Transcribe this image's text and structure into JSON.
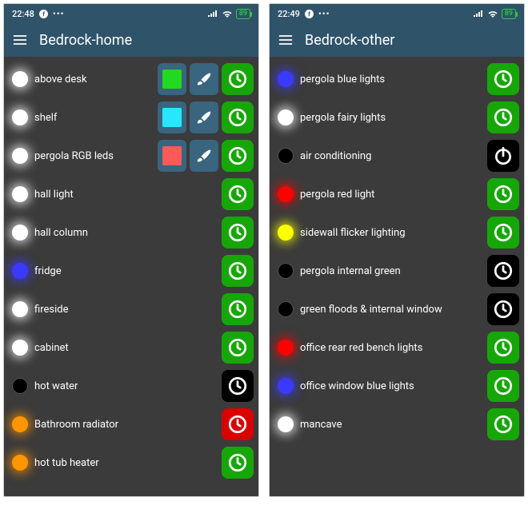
{
  "left": {
    "status": {
      "time": "22:48",
      "battery": "89"
    },
    "title": "Bedrock-home",
    "rows": [
      {
        "label": "above desk",
        "bulb": "white-glow",
        "color_swatch": "#21d921",
        "brush": true,
        "action": "clock",
        "action_bg": "green"
      },
      {
        "label": "shelf",
        "bulb": "white-glow",
        "color_swatch": "#25e8ff",
        "brush": true,
        "action": "clock",
        "action_bg": "green"
      },
      {
        "label": "pergola RGB leds",
        "bulb": "white-glow",
        "color_swatch": "#ff5959",
        "brush": true,
        "action": "clock",
        "action_bg": "green"
      },
      {
        "label": "hall light",
        "bulb": "white-glow",
        "action": "clock",
        "action_bg": "green"
      },
      {
        "label": "hall column",
        "bulb": "white-glow",
        "action": "clock",
        "action_bg": "green"
      },
      {
        "label": "fridge",
        "bulb": "blue",
        "action": "clock",
        "action_bg": "green"
      },
      {
        "label": "fireside",
        "bulb": "white-glow",
        "action": "clock",
        "action_bg": "green"
      },
      {
        "label": "cabinet",
        "bulb": "white-glow",
        "action": "clock",
        "action_bg": "green"
      },
      {
        "label": "hot water",
        "bulb": "black",
        "action": "clock",
        "action_bg": "black"
      },
      {
        "label": "Bathroom radiator",
        "bulb": "orange",
        "action": "clock",
        "action_bg": "red"
      },
      {
        "label": "hot tub heater",
        "bulb": "orange",
        "action": "clock",
        "action_bg": "green"
      }
    ]
  },
  "right": {
    "status": {
      "time": "22:49",
      "battery": "89"
    },
    "title": "Bedrock-other",
    "rows": [
      {
        "label": "pergola blue lights",
        "bulb": "blue",
        "action": "clock",
        "action_bg": "green"
      },
      {
        "label": "pergola fairy lights",
        "bulb": "white-glow",
        "action": "clock",
        "action_bg": "green"
      },
      {
        "label": "air conditioning",
        "bulb": "black",
        "action": "power",
        "action_bg": "black"
      },
      {
        "label": "pergola red light",
        "bulb": "red",
        "action": "clock",
        "action_bg": "green"
      },
      {
        "label": "sidewall flicker lighting",
        "bulb": "yellow",
        "action": "clock",
        "action_bg": "green"
      },
      {
        "label": "pergola internal green",
        "bulb": "black",
        "action": "clock",
        "action_bg": "black"
      },
      {
        "label": "green floods & internal window",
        "bulb": "black",
        "action": "clock",
        "action_bg": "black"
      },
      {
        "label": "office rear red bench lights",
        "bulb": "red",
        "action": "clock",
        "action_bg": "green"
      },
      {
        "label": "office window blue lights",
        "bulb": "blue",
        "action": "clock",
        "action_bg": "green"
      },
      {
        "label": "mancave",
        "bulb": "white-glow",
        "action": "clock",
        "action_bg": "green"
      }
    ]
  },
  "bulb_styles": {
    "white-glow": {
      "bg": "#ffffff",
      "glow": "#ffffff"
    },
    "blue": {
      "bg": "#3a3aff",
      "glow": "#3a3aff"
    },
    "black": {
      "bg": "#000000",
      "glow": null
    },
    "orange": {
      "bg": "#ff9500",
      "glow": "#ff9500"
    },
    "red": {
      "bg": "#ff0000",
      "glow": "#ff0000"
    },
    "yellow": {
      "bg": "#ffff00",
      "glow": "#ffff00"
    }
  },
  "action_bg": {
    "green": "#17a608",
    "black": "#000000",
    "red": "#d90000"
  }
}
